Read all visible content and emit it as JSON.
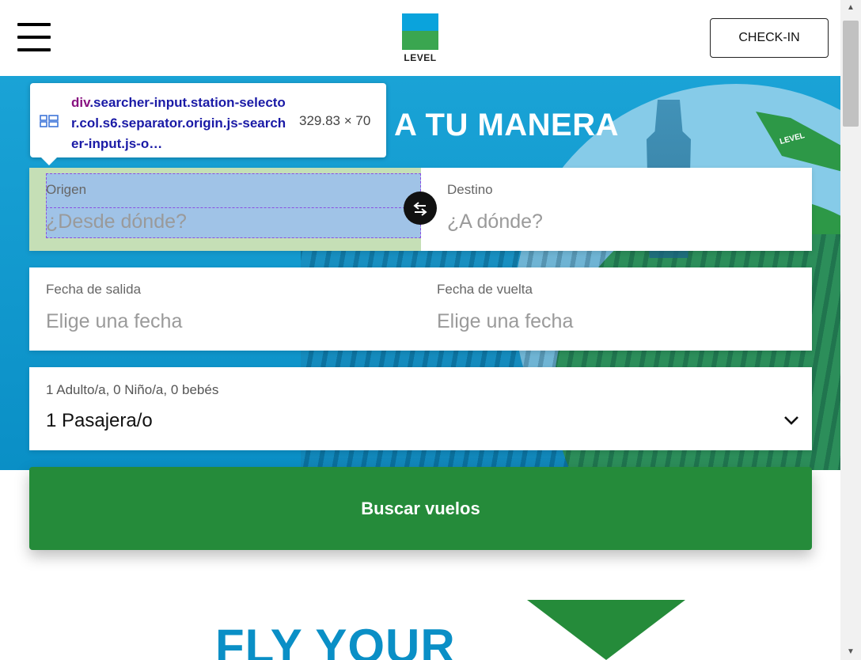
{
  "header": {
    "logo_text": "LEVEL",
    "checkin_label": "CHECK-IN"
  },
  "hero": {
    "title": "A TU MANERA",
    "plane_label": "LEVEL"
  },
  "tooltip": {
    "tag": "div",
    "selector": ".searcher-input.station-selector.col.s6.separator.origin.js-searcher-input.js-o…",
    "size": "329.83 × 70"
  },
  "search": {
    "origin": {
      "label": "Origen",
      "placeholder": "¿Desde dónde?"
    },
    "destination": {
      "label": "Destino",
      "placeholder": "¿A dónde?"
    },
    "departure": {
      "label": "Fecha de salida",
      "placeholder": "Elige una fecha"
    },
    "return": {
      "label": "Fecha de vuelta",
      "placeholder": "Elige una fecha"
    },
    "passengers": {
      "summary": "1 Adulto/a, 0 Niño/a, 0 bebés",
      "value": "1 Pasajera/o"
    },
    "submit_label": "Buscar vuelos"
  },
  "promo": {
    "title": "FLY YOUR"
  },
  "colors": {
    "brand_blue": "#0aa3dc",
    "brand_green": "#258b3a"
  }
}
